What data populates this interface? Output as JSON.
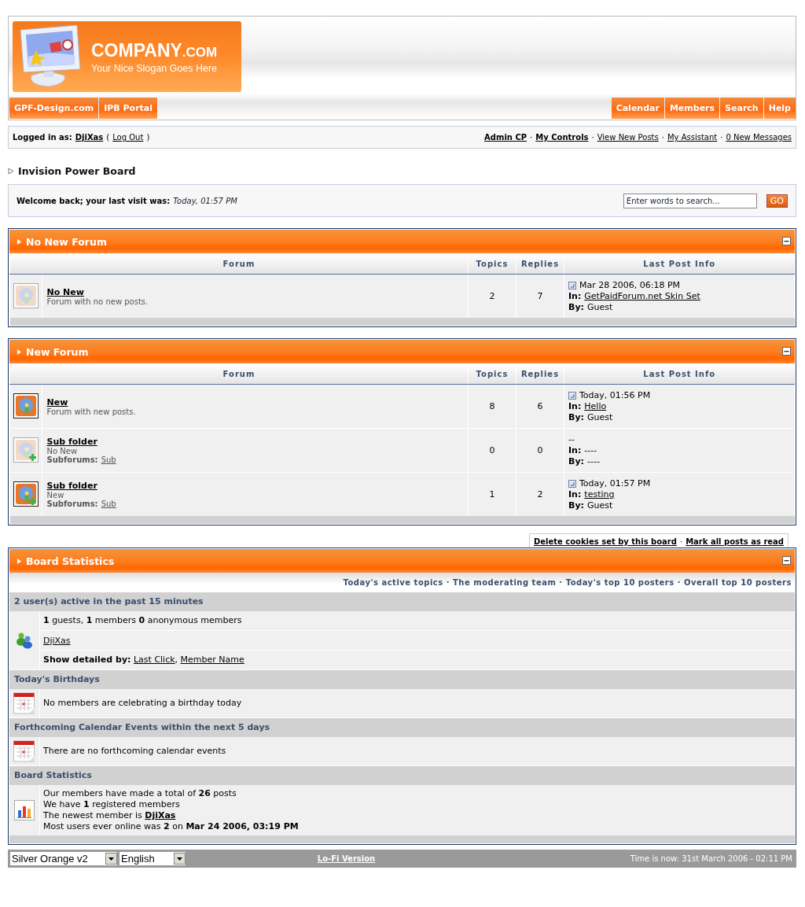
{
  "header": {
    "logo_name": "COMPANY",
    "logo_suffix": ".COM",
    "slogan": "Your Nice Slogan Goes Here",
    "nav_left": [
      "GPF-Design.com",
      "IPB Portal"
    ],
    "nav_right": [
      "Calendar",
      "Members",
      "Search",
      "Help"
    ]
  },
  "userbar": {
    "label": "Logged in as:",
    "user": "DjiXas",
    "open_paren": "(",
    "logout": "Log Out",
    "close_paren": ")",
    "separator": "·",
    "links": [
      {
        "label": "Admin CP",
        "bold": true
      },
      {
        "label": "My Controls",
        "bold": true
      },
      {
        "label": "View New Posts",
        "bold": false
      },
      {
        "label": "My Assistant",
        "bold": false
      },
      {
        "label": "0 New Messages",
        "bold": false
      }
    ]
  },
  "breadcrumb": "Invision Power Board",
  "welcome": {
    "label": "Welcome back; your last visit was:",
    "time": "Today, 01:57 PM",
    "search_placeholder": "Enter words to search...",
    "go": "GO"
  },
  "categories": [
    {
      "title": "No New Forum",
      "columns": [
        "Forum",
        "Topics",
        "Replies",
        "Last Post Info"
      ],
      "forums": [
        {
          "name": "No New",
          "description": "Forum with no new posts.",
          "is_new": false,
          "topics": "2",
          "replies": "7",
          "last_post": {
            "has_post": true,
            "date": "Mar 28 2006, 06:18 PM",
            "in_label": "In:",
            "in": "GetPaidForum.net Skin Set",
            "by_label": "By:",
            "by": "Guest"
          }
        }
      ]
    },
    {
      "title": "New Forum",
      "columns": [
        "Forum",
        "Topics",
        "Replies",
        "Last Post Info"
      ],
      "forums": [
        {
          "name": "New",
          "description": "Forum with new posts.",
          "is_new": true,
          "topics": "8",
          "replies": "6",
          "last_post": {
            "has_post": true,
            "date": "Today, 01:56 PM",
            "in_label": "In:",
            "in": "Hello",
            "by_label": "By:",
            "by": "Guest"
          }
        },
        {
          "name": "Sub folder",
          "description": "No New",
          "is_new": false,
          "subforums_label": "Subforums:",
          "subforums": [
            "Sub"
          ],
          "topics": "0",
          "replies": "0",
          "last_post": {
            "has_post": false,
            "date": "--",
            "in_label": "In:",
            "in": "----",
            "by_label": "By:",
            "by": "----"
          }
        },
        {
          "name": "Sub folder",
          "description": "New",
          "is_new": true,
          "subforums_label": "Subforums:",
          "subforums": [
            "Sub"
          ],
          "topics": "1",
          "replies": "2",
          "last_post": {
            "has_post": true,
            "date": "Today, 01:57 PM",
            "in_label": "In:",
            "in": "testing",
            "by_label": "By:",
            "by": "Guest"
          }
        }
      ]
    }
  ],
  "board_links": {
    "separator": "·",
    "links": [
      "Delete cookies set by this board",
      "Mark all posts as read"
    ]
  },
  "stats": {
    "title": "Board Statistics",
    "separator": "·",
    "links": [
      "Today's active topics",
      "The moderating team",
      "Today's top 10 posters",
      "Overall top 10 posters"
    ],
    "sections": [
      {
        "heading": "2 user(s) active in the past 15 minutes",
        "kind": "users",
        "rows": [
          [
            [
              {
                "text": "**1** guests, **1** members **0** anonymous members",
                "link": false
              }
            ]
          ],
          [
            [
              {
                "text": "DjiXas",
                "link": true,
                "bold": false
              }
            ]
          ],
          [
            [
              {
                "text": "**Show detailed by:** ",
                "link": false
              },
              {
                "text": "Last Click",
                "link": true,
                "bold": false
              },
              {
                "text": ", ",
                "link": false
              },
              {
                "text": "Member Name",
                "link": true,
                "bold": false
              }
            ]
          ]
        ]
      },
      {
        "heading": "Today's Birthdays",
        "kind": "calendar",
        "rows": [
          [
            [
              {
                "text": "No members are celebrating a birthday today",
                "link": false
              }
            ]
          ]
        ]
      },
      {
        "heading": "Forthcoming Calendar Events within the next 5 days",
        "kind": "calendar",
        "rows": [
          [
            [
              {
                "text": "There are no forthcoming calendar events",
                "link": false
              }
            ]
          ]
        ]
      },
      {
        "heading": "Board Statistics",
        "kind": "chart",
        "rows": [
          [
            [
              {
                "text": "Our members have made a total of **26** posts",
                "link": false
              }
            ],
            [
              {
                "text": "We have **1** registered members",
                "link": false
              }
            ],
            [
              {
                "text": "The newest member is ",
                "link": false
              },
              {
                "text": "DjiXas",
                "link": true,
                "bold": true
              }
            ],
            [
              {
                "text": "Most users ever online was **2** on **Mar 24 2006, 03:19 PM**",
                "link": false
              }
            ]
          ]
        ]
      }
    ]
  },
  "bottom_bar": {
    "skin": "Silver Orange v2",
    "language": "English",
    "lofi": "Lo-Fi Version",
    "time": "Time is now: 31st March 2006 - 02:11 PM"
  }
}
